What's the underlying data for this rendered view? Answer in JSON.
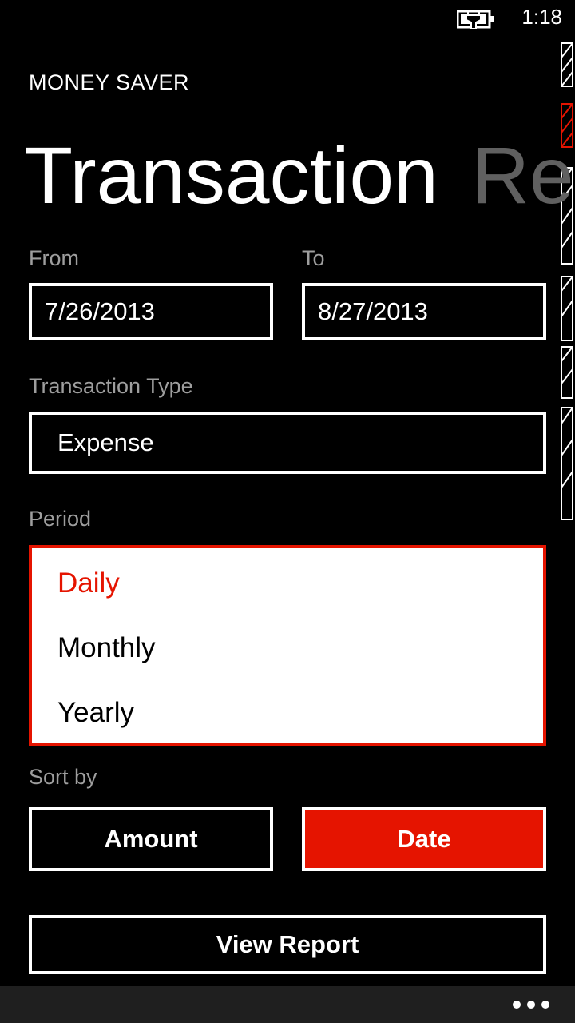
{
  "status_bar": {
    "time": "1:18",
    "battery_icon": "battery-charging-icon"
  },
  "app": {
    "title": "MONEY SAVER"
  },
  "pivot": {
    "active": "Transaction",
    "next": "Re"
  },
  "date_range": {
    "from_label": "From",
    "from_value": "7/26/2013",
    "to_label": "To",
    "to_value": "8/27/2013"
  },
  "transaction_type": {
    "label": "Transaction Type",
    "value": "Expense"
  },
  "period": {
    "label": "Period",
    "options": [
      "Daily",
      "Monthly",
      "Yearly"
    ],
    "selected": "Daily"
  },
  "sort_by": {
    "label": "Sort by",
    "options": [
      "Amount",
      "Date"
    ],
    "selected": "Date"
  },
  "actions": {
    "view_report": "View Report"
  },
  "app_bar": {
    "more_icon": "more-ellipsis-icon"
  },
  "colors": {
    "accent": "#e51400",
    "background": "#000000",
    "foreground": "#ffffff",
    "subtle": "#9e9e9e"
  }
}
